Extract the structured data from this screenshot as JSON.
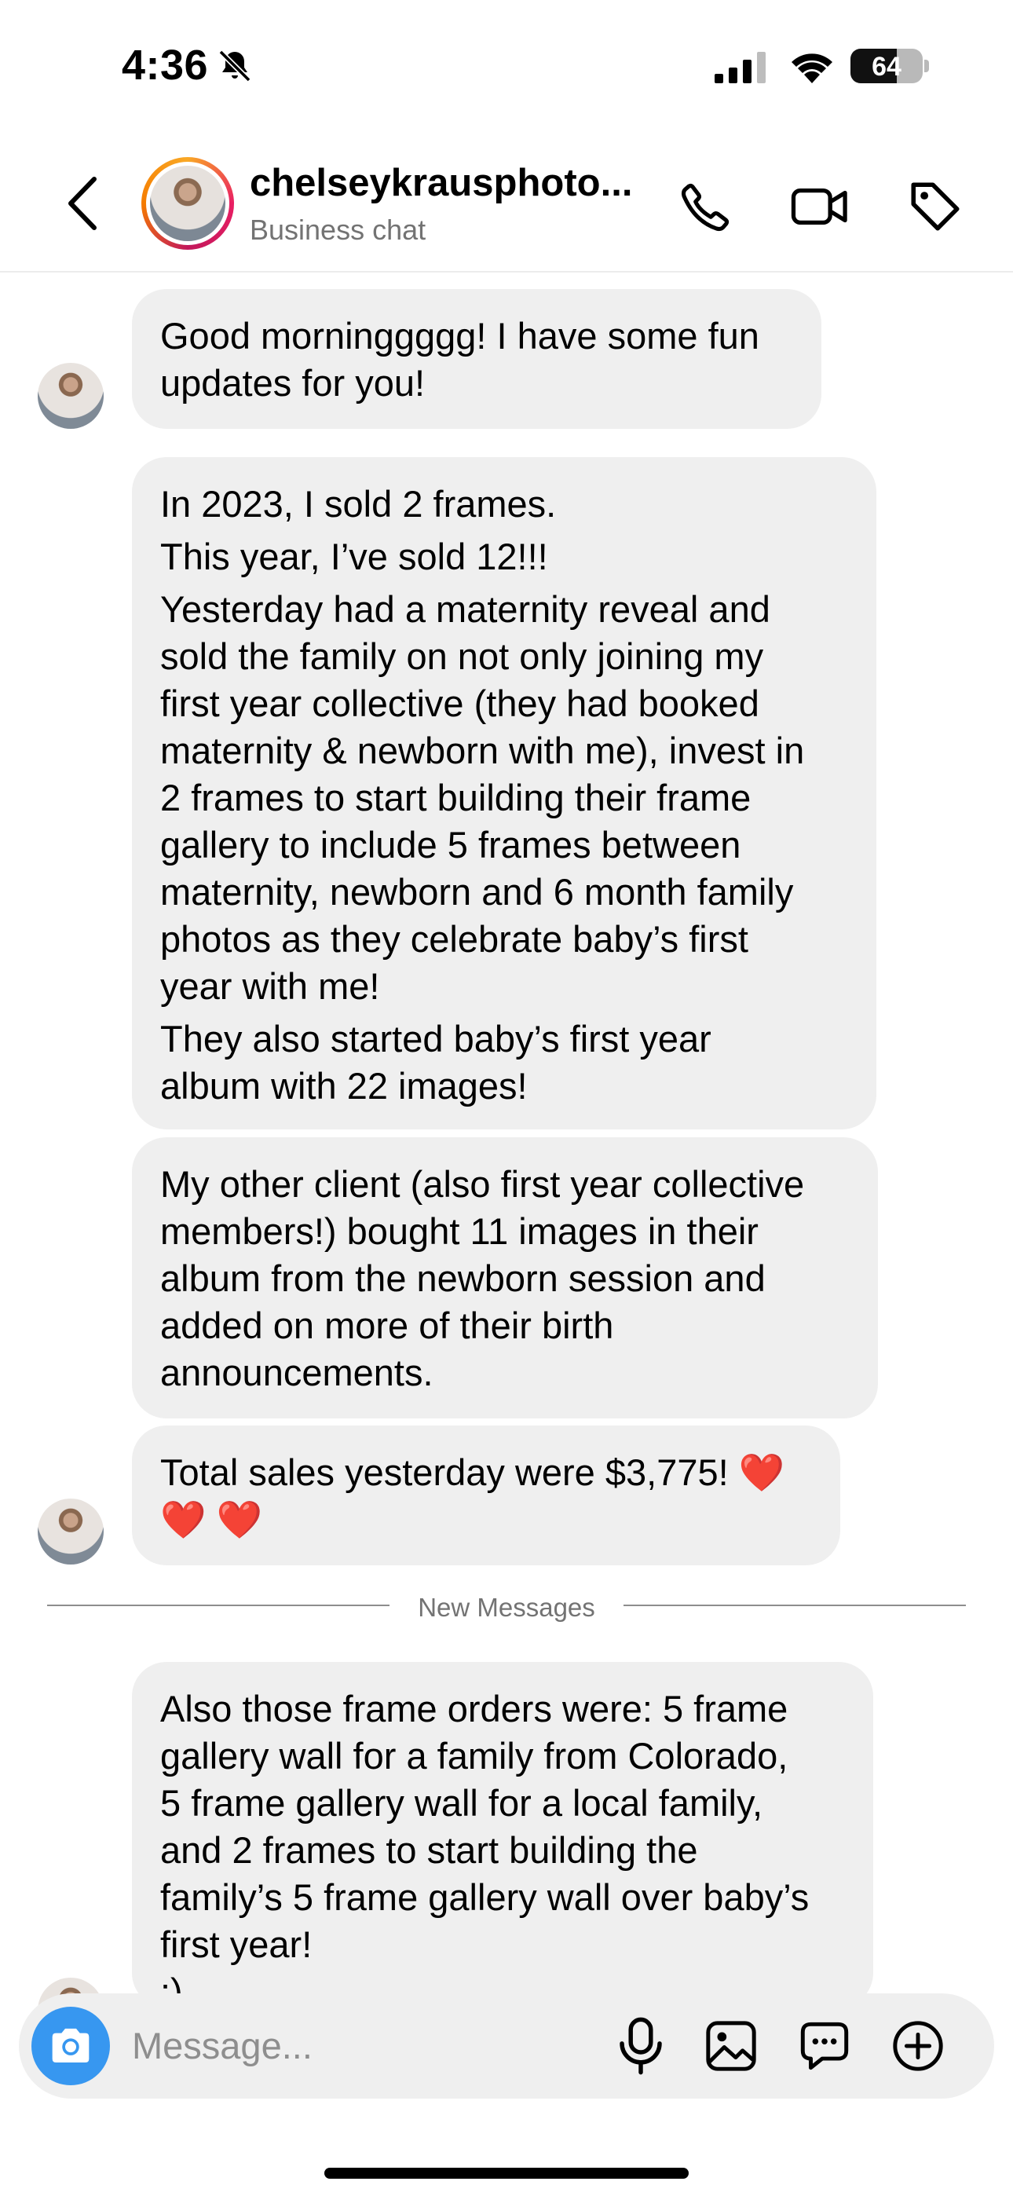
{
  "status_bar": {
    "time": "4:36",
    "battery": "64",
    "battery_level": 0.64,
    "icons": [
      "bell-slash-icon",
      "signal-icon",
      "wifi-icon",
      "battery-icon"
    ]
  },
  "header": {
    "name": "chelseykrausphoto...",
    "subtitle": "Business chat",
    "icons": [
      "back-chevron-icon",
      "phone-icon",
      "video-camera-icon",
      "tag-icon"
    ]
  },
  "messages": [
    {
      "paragraphs": [
        "Good morninggggg! I have some fun\nupdates for you!"
      ]
    },
    {
      "paragraphs": [
        "In 2023, I sold 2 frames.",
        "This year, I’ve sold 12!!!",
        "Yesterday had a maternity reveal and\nsold the family on not only joining my\nfirst year collective (they had booked\nmaternity & newborn with me), invest in\n2 frames to start building their frame\ngallery to include  5 frames between\nmaternity, newborn and 6 month family\nphotos as they celebrate baby’s first\nyear with me!",
        "They also started baby’s first year\nalbum with 22 images!"
      ]
    },
    {
      "paragraphs": [
        "My other client (also first year collective\nmembers!) bought 11 images in their\nalbum from the newborn session and\nadded on more of their birth\nannouncements."
      ]
    },
    {
      "paragraphs": [
        "Total sales yesterday were $3,775! ❤️\n❤️ ❤️"
      ]
    },
    {
      "paragraphs": [
        "Also those frame orders were: 5 frame\ngallery wall for a family from Colorado,\n5 frame gallery wall for a local family,\nand 2 frames to start building the\nfamily’s 5 frame gallery wall over baby’s\nfirst year!\n:)"
      ]
    }
  ],
  "divider": {
    "label": "New Messages"
  },
  "composer": {
    "placeholder": "Message...",
    "icons": [
      "camera-icon",
      "microphone-icon",
      "gallery-icon",
      "sticker-icon",
      "plus-icon"
    ]
  },
  "colors": {
    "accent": "#3797f0",
    "bubble": "#efefef",
    "secondary_text": "#737373"
  }
}
